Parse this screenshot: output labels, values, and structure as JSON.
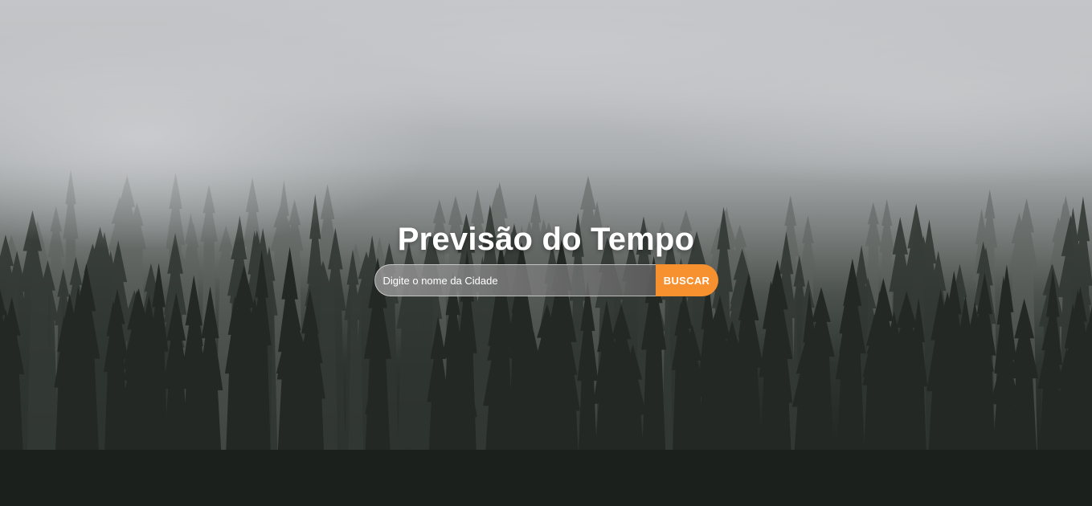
{
  "page": {
    "title": "Previsão do Tempo"
  },
  "search": {
    "placeholder": "Digite o nome da Cidade",
    "value": "",
    "button_label": "BUSCAR"
  },
  "colors": {
    "button_accent": "#f7912f",
    "title_text": "#ffffff"
  },
  "background": {
    "description_icon": "misty-forest-background"
  }
}
